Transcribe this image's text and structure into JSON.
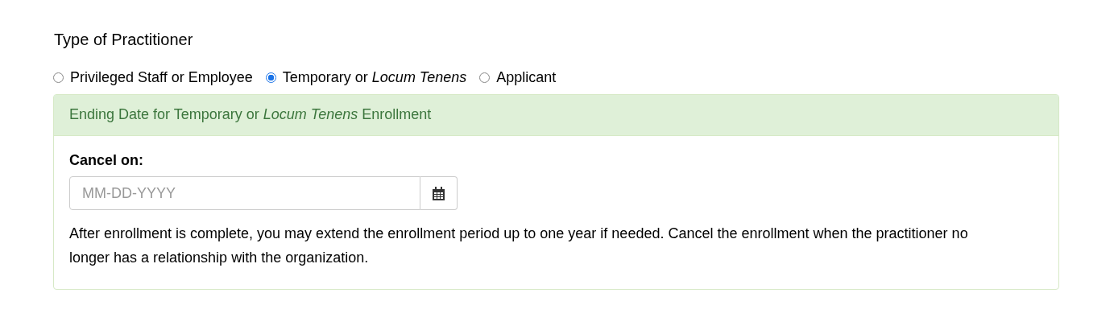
{
  "section_title": "Type of Practitioner",
  "practitioner_types": [
    {
      "label": "Privileged Staff or Employee",
      "selected": false
    },
    {
      "label": "Temporary or *Locum Tenens*",
      "selected": true
    },
    {
      "label": "Applicant",
      "selected": false
    }
  ],
  "panel": {
    "heading": "Ending Date for Temporary or *Locum Tenens* Enrollment",
    "field_label": "Cancel on:",
    "date_field": {
      "placeholder": "MM-DD-YYYY"
    },
    "help_text": "After enrollment is complete, you may extend the enrollment period up to one year if needed. Cancel the enrollment when the practitioner no longer has a relationship with the organization."
  }
}
